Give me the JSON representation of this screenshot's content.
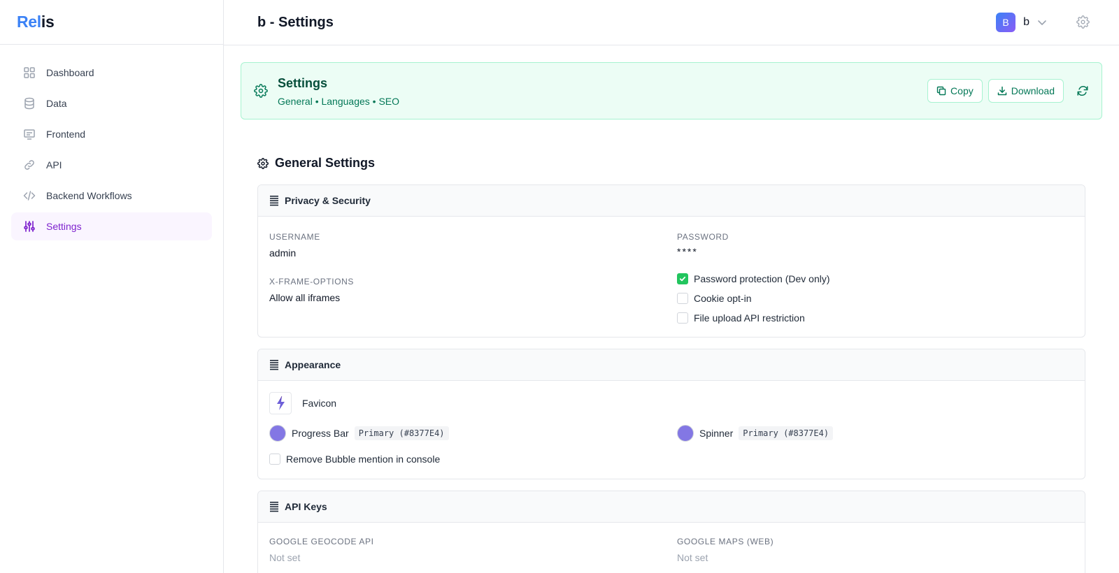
{
  "brand": {
    "part1": "Rel",
    "part2": "is"
  },
  "sidebar": {
    "items": [
      {
        "label": "Dashboard",
        "icon": "grid-icon"
      },
      {
        "label": "Data",
        "icon": "database-icon"
      },
      {
        "label": "Frontend",
        "icon": "monitor-icon"
      },
      {
        "label": "API",
        "icon": "link-icon"
      },
      {
        "label": "Backend Workflows",
        "icon": "code-icon"
      },
      {
        "label": "Settings",
        "icon": "sliders-icon",
        "active": true
      }
    ]
  },
  "header": {
    "title": "b - Settings",
    "avatar_initial": "B",
    "user_name": "b"
  },
  "banner": {
    "title": "Settings",
    "breadcrumbs": "General • Languages • SEO",
    "copy_label": "Copy",
    "download_label": "Download"
  },
  "general": {
    "title": "General Settings",
    "privacy": {
      "title": "Privacy & Security",
      "username_label": "USERNAME",
      "username_value": "admin",
      "password_label": "PASSWORD",
      "password_value": "****",
      "xframe_label": "X-FRAME-OPTIONS",
      "xframe_value": "Allow all iframes",
      "checks": [
        {
          "label": "Password protection (Dev only)",
          "checked": true
        },
        {
          "label": "Cookie opt-in",
          "checked": false
        },
        {
          "label": "File upload API restriction",
          "checked": false
        }
      ]
    },
    "appearance": {
      "title": "Appearance",
      "favicon_label": "Favicon",
      "progress_label": "Progress Bar",
      "progress_value": "Primary (#8377E4)",
      "spinner_label": "Spinner",
      "spinner_value": "Primary (#8377E4)",
      "remove_bubble_label": "Remove Bubble mention in console",
      "remove_bubble_checked": false
    },
    "api_keys": {
      "title": "API Keys",
      "geocode_label": "GOOGLE GEOCODE API",
      "geocode_value": "Not set",
      "maps_label": "GOOGLE MAPS (WEB)",
      "maps_value": "Not set"
    }
  },
  "colors": {
    "accent": "#7e22ce",
    "success": "#047857",
    "primary": "#8377E4",
    "brand_blue": "#3b82f6"
  }
}
